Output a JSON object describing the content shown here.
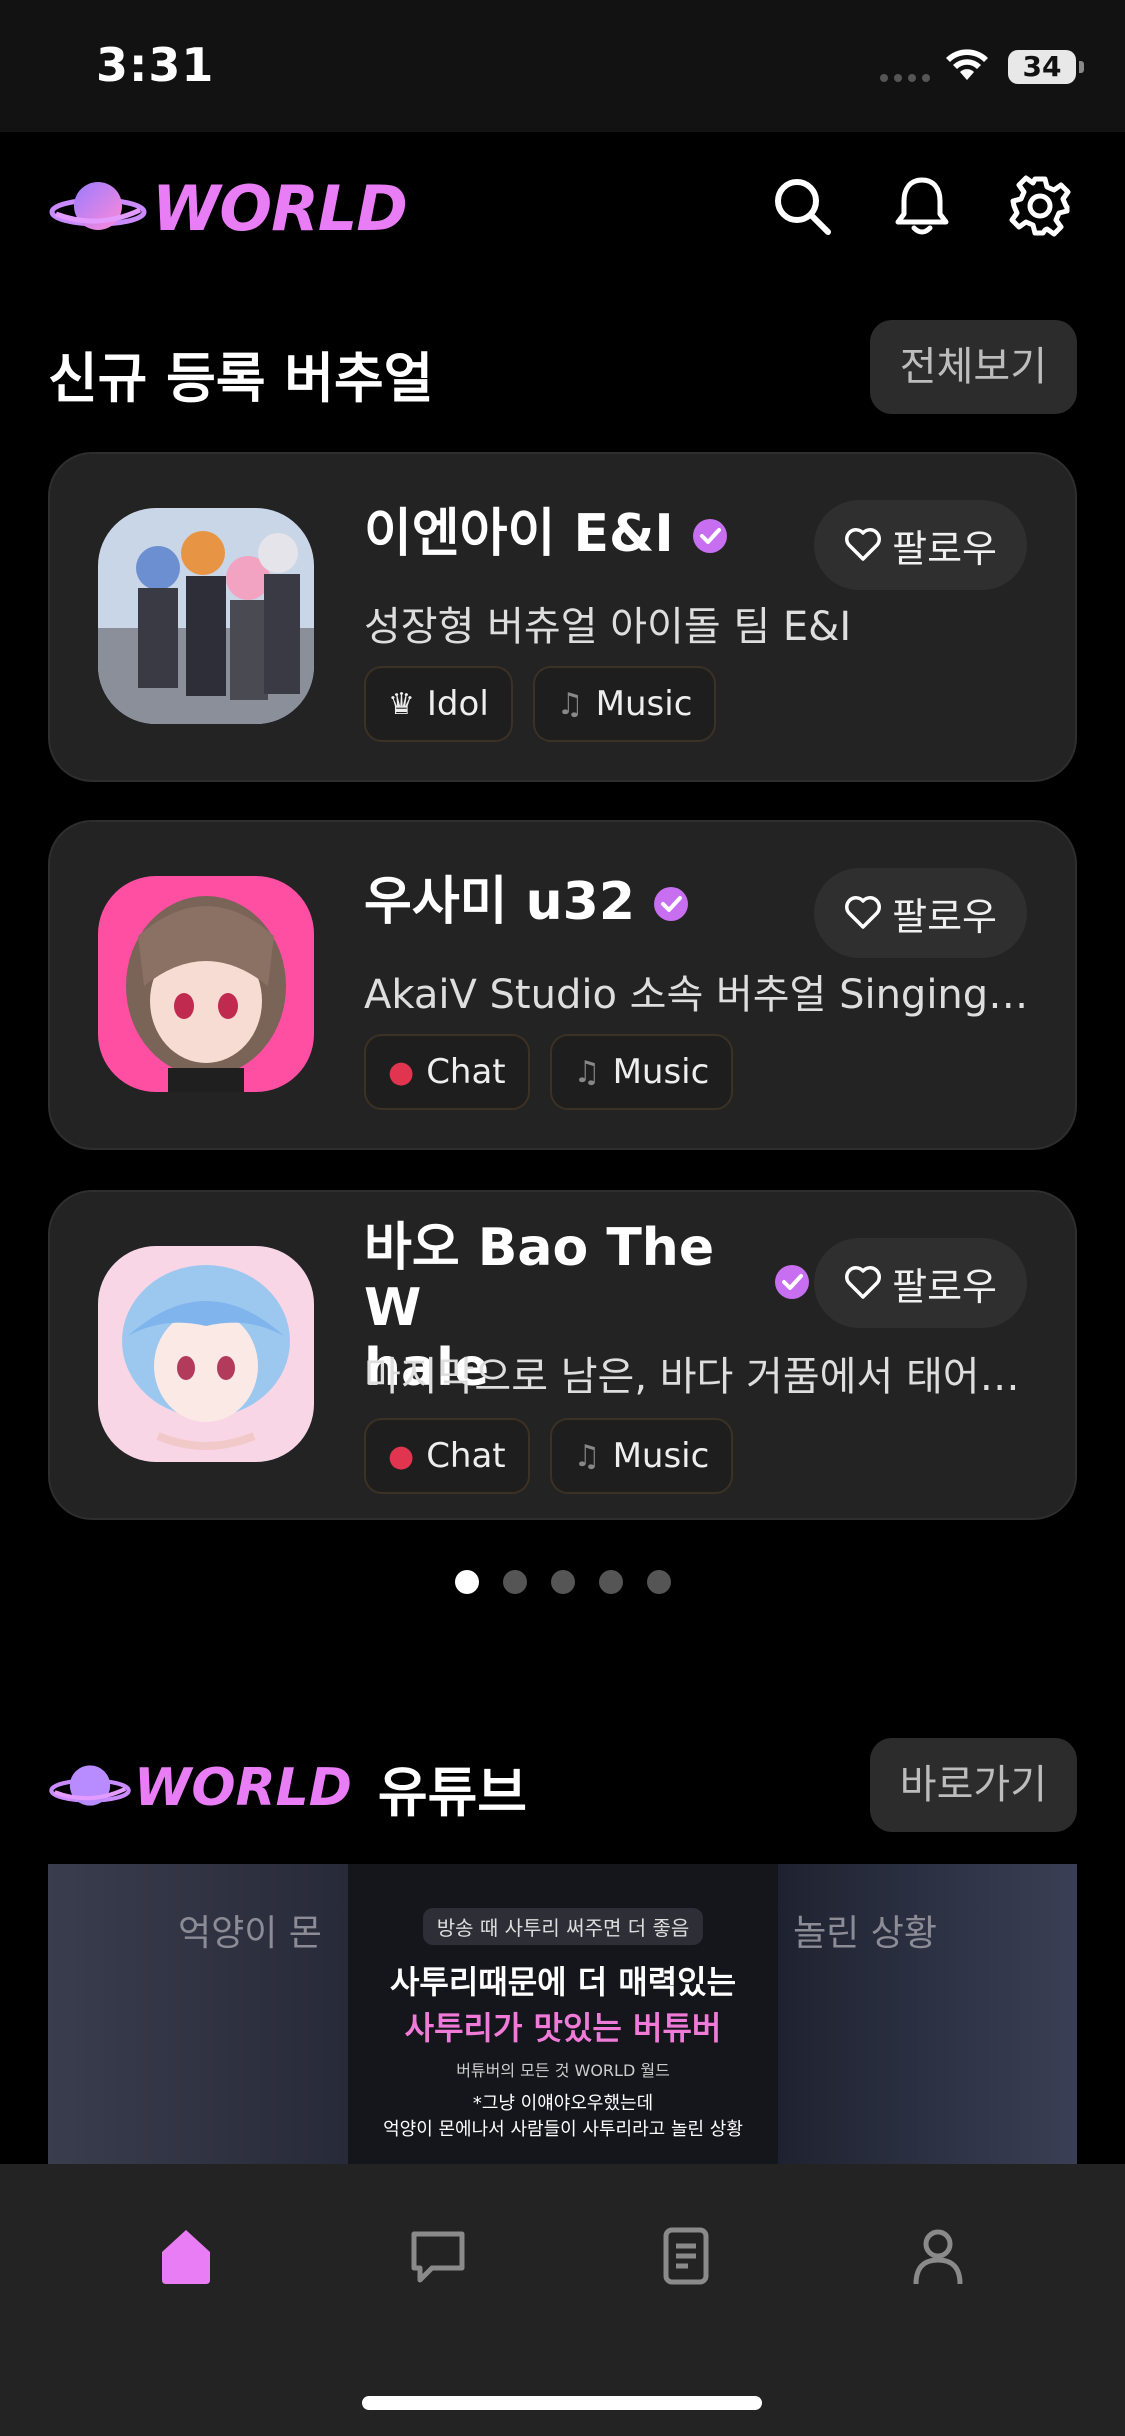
{
  "status_bar": {
    "time": "3:31",
    "battery": "34"
  },
  "brand": {
    "logo_text": "WORLD",
    "accent_color": "#e97df5"
  },
  "header_icons": [
    "search-icon",
    "bell-icon",
    "gear-icon"
  ],
  "new_vtubers": {
    "title": "신규 등록 버추얼",
    "view_all_label": "전체보기",
    "cards": [
      {
        "name": "이엔아이 E&I",
        "description": "성장형 버츄얼 아이돌 팀 E&I",
        "follow_label": "팔로우",
        "tags": [
          {
            "icon": "idol-emoji",
            "label": "Idol"
          },
          {
            "icon": "music-note-icon",
            "label": "Music"
          }
        ]
      },
      {
        "name": "우사미 u32",
        "description": "AkaiV Studio 소속 버추얼 Singing an…",
        "follow_label": "팔로우",
        "tags": [
          {
            "icon": "lips-emoji",
            "label": "Chat"
          },
          {
            "icon": "music-note-icon",
            "label": "Music"
          }
        ]
      },
      {
        "name_line1": "바오 Bao The W",
        "name_line2": "hale",
        "description": "마지막으로 남은, 바다 거품에서 태어난…",
        "follow_label": "팔로우",
        "tags": [
          {
            "icon": "lips-emoji",
            "label": "Chat"
          },
          {
            "icon": "music-note-icon",
            "label": "Music"
          }
        ]
      }
    ]
  },
  "pagination": {
    "total": 5,
    "active_index": 0
  },
  "youtube_section": {
    "logo_text": "WORLD",
    "title": "유튜브",
    "go_label": "바로가기",
    "thumbnail": {
      "badge": "방송 때 사투리 써주면 더 좋음",
      "headline_line1": "사투리때문에 더 매력있는",
      "headline_line2": "사투리가 맛있는 버튜버",
      "byline": "버튜버의 모든 것 WORLD 월드",
      "caption_line1": "*그냥 이얘야오우했는데",
      "caption_line2": "억양이 몬에나서 사람들이 사투리라고 놀린 상황",
      "bg_left": "억양이 몬",
      "bg_right": "놀린 상황"
    }
  },
  "tab_bar": [
    "home-icon",
    "chat-icon",
    "document-icon",
    "profile-icon"
  ]
}
